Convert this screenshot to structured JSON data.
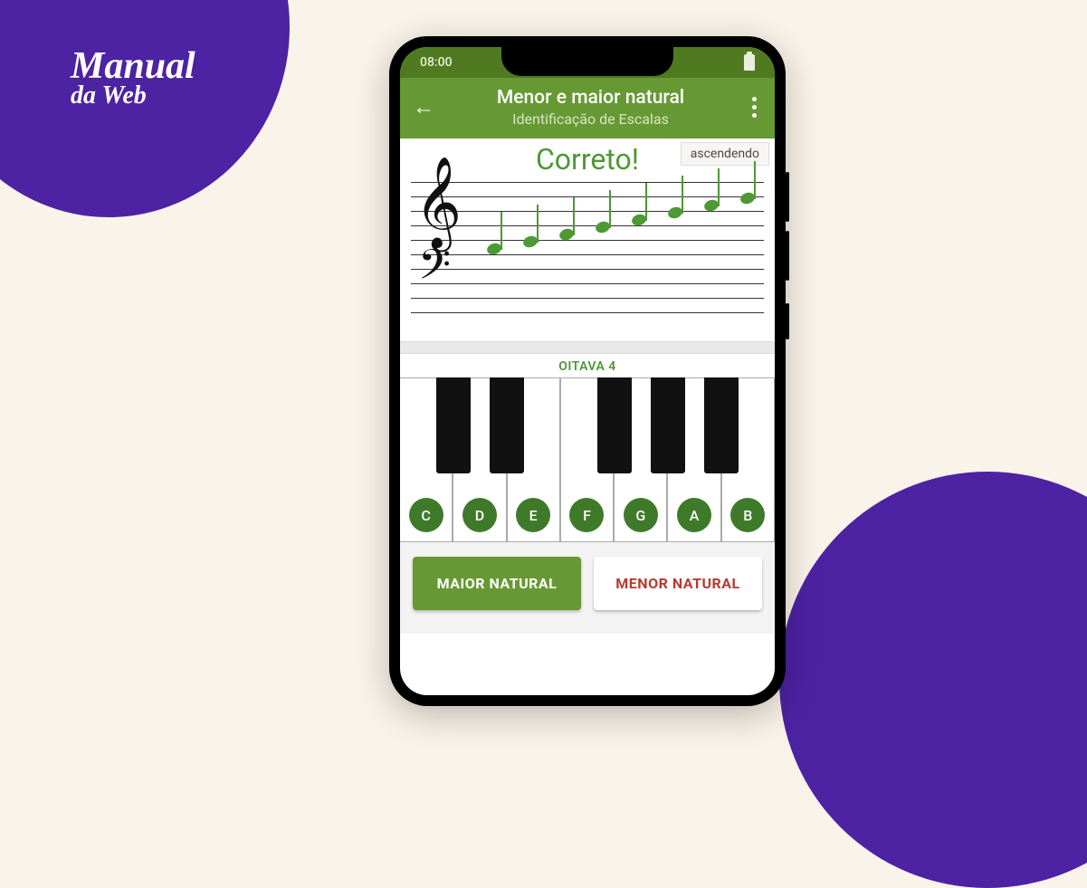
{
  "brand": {
    "line1": "Manual",
    "line2": "da Web"
  },
  "status": {
    "time": "08:00"
  },
  "header": {
    "title": "Menor e maior natural",
    "subtitle": "Identificação de Escalas"
  },
  "feedback": {
    "result": "Correto!",
    "direction_badge": "ascendendo"
  },
  "octave_label": "OITAVA 4",
  "piano": {
    "white_keys": [
      "C",
      "D",
      "E",
      "F",
      "G",
      "A",
      "B"
    ]
  },
  "answers": {
    "option_a": "MAIOR NATURAL",
    "option_b": "MENOR NATURAL"
  },
  "colors": {
    "accent_purple": "#4d22a3",
    "app_green": "#669933",
    "note_green": "#4d9933"
  }
}
